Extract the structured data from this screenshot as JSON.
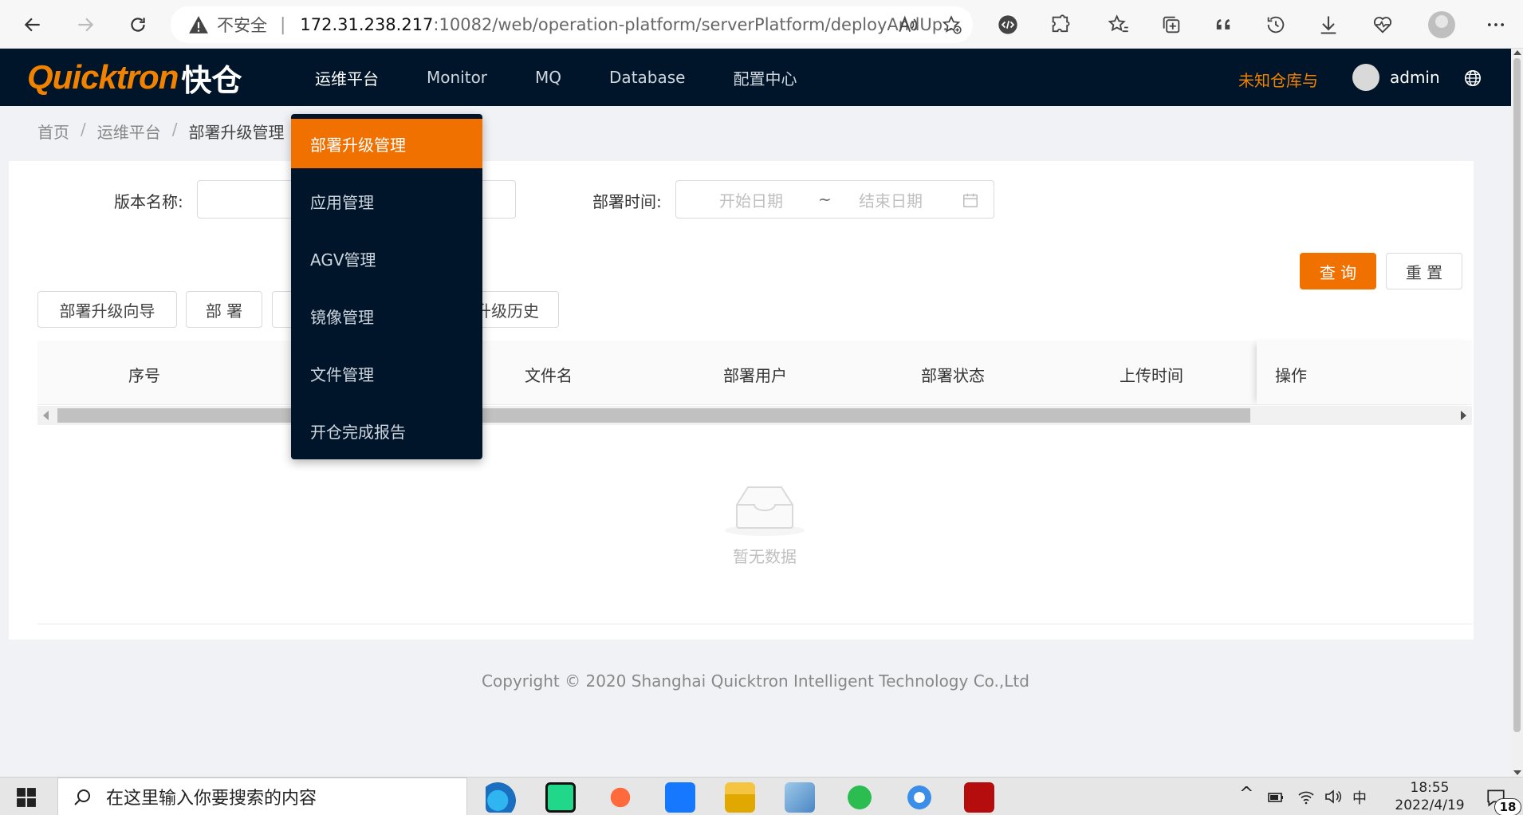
{
  "browser": {
    "insecure_label": "不安全",
    "url_host": "172.31.238.217",
    "url_path": ":10082/web/operation-platform/serverPlatform/deployAndUp..."
  },
  "header": {
    "logo_latin": "Quicktron",
    "logo_cn": "快仓",
    "nav": [
      {
        "label": "运维平台"
      },
      {
        "label": "Monitor"
      },
      {
        "label": "MQ"
      },
      {
        "label": "Database"
      },
      {
        "label": "配置中心"
      }
    ],
    "warehouse": "未知仓库与",
    "username": "admin"
  },
  "breadcrumb": {
    "items": [
      "首页",
      "运维平台",
      "部署升级管理"
    ],
    "separator": "/"
  },
  "form": {
    "version_label": "版本名称:",
    "deploy_time_label": "部署时间:",
    "start_placeholder": "开始日期",
    "range_separator": "~",
    "end_placeholder": "结束日期",
    "query_button": "查 询",
    "reset_button": "重 置"
  },
  "actions": {
    "wizard": "部署升级向导",
    "deploy": "部 署",
    "history_partial": "升级历史"
  },
  "table": {
    "columns": [
      "序号",
      "文件名",
      "部署用户",
      "部署状态",
      "上传时间",
      "操作"
    ],
    "empty_text": "暂无数据"
  },
  "footer": {
    "copyright": "Copyright © 2020 Shanghai Quicktron Intelligent Technology Co.,Ltd"
  },
  "dropdown": {
    "items": [
      {
        "label": "部署升级管理"
      },
      {
        "label": "应用管理"
      },
      {
        "label": "AGV管理"
      },
      {
        "label": "镜像管理"
      },
      {
        "label": "文件管理"
      },
      {
        "label": "开仓完成报告"
      }
    ]
  },
  "taskbar": {
    "search_placeholder": "在这里输入你要搜索的内容",
    "ime": "中",
    "time": "18:55",
    "date": "2022/4/19",
    "notification_count": "18"
  },
  "colors": {
    "accent": "#f07000",
    "header_bg": "#001529"
  }
}
